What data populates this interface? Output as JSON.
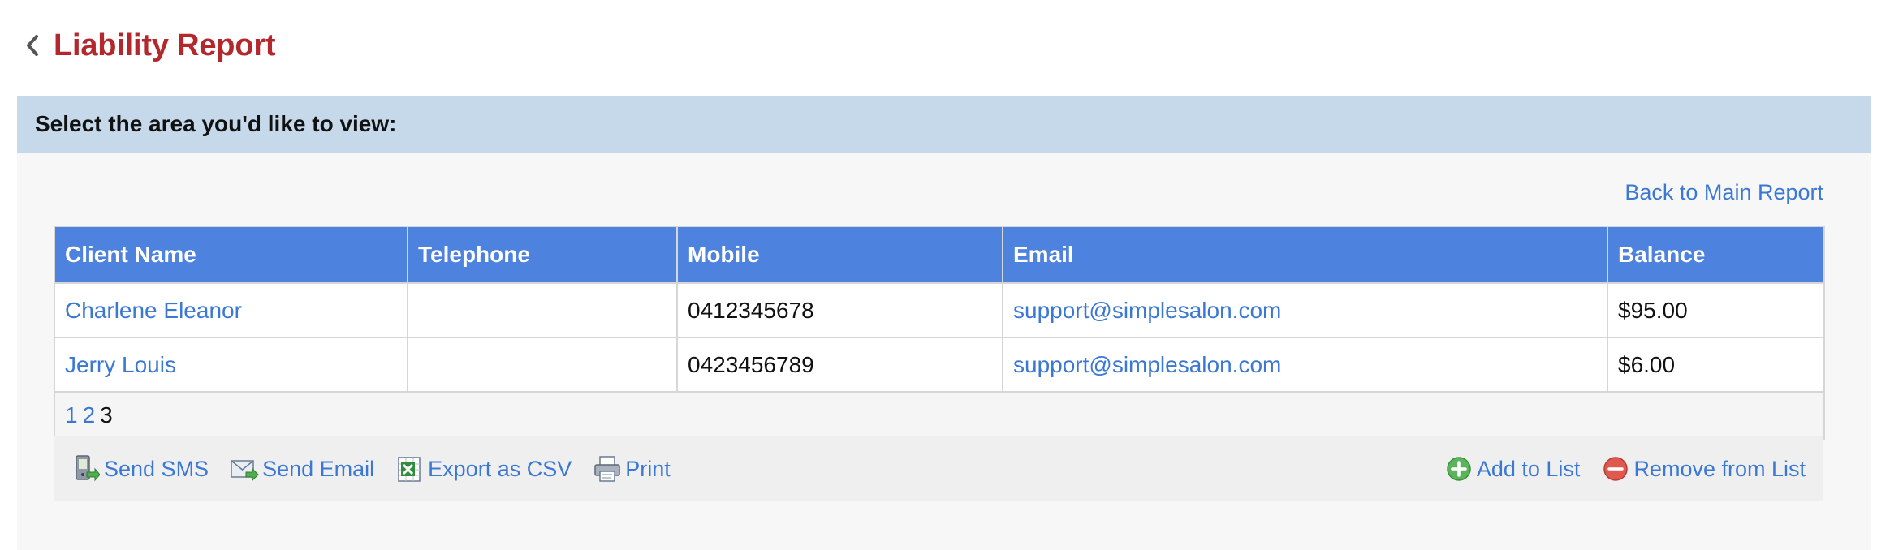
{
  "header": {
    "title": "Liability Report"
  },
  "area": {
    "label": "Select the area you'd like to view:"
  },
  "back_link": "Back to Main Report",
  "table": {
    "columns": [
      "Client Name",
      "Telephone",
      "Mobile",
      "Email",
      "Balance"
    ],
    "rows": [
      {
        "client_name": "Charlene Eleanor",
        "telephone": "",
        "mobile": "0412345678",
        "email": "support@simplesalon.com",
        "balance": "$95.00"
      },
      {
        "client_name": "Jerry Louis",
        "telephone": "",
        "mobile": "0423456789",
        "email": "support@simplesalon.com",
        "balance": "$6.00"
      }
    ]
  },
  "pagination": {
    "pages": [
      "1",
      "2",
      "3"
    ],
    "current": "3"
  },
  "actions": {
    "send_sms": "Send SMS",
    "send_email": "Send Email",
    "export_csv": "Export as CSV",
    "print": "Print",
    "add_to_list": "Add to List",
    "remove_from_list": "Remove from List"
  },
  "icons": {
    "back": "chevron-left-icon",
    "send_sms": "mobile-phone-icon",
    "send_email": "envelope-icon",
    "export_csv": "spreadsheet-icon",
    "print": "printer-icon",
    "add_to_list": "plus-circle-icon",
    "remove_from_list": "minus-circle-icon"
  },
  "colors": {
    "title": "#b3282d",
    "area_bar": "#c5d9ea",
    "table_header": "#4d82df",
    "link": "#3a78d4",
    "add_icon": "#5bb35b",
    "remove_icon": "#e0594f"
  }
}
